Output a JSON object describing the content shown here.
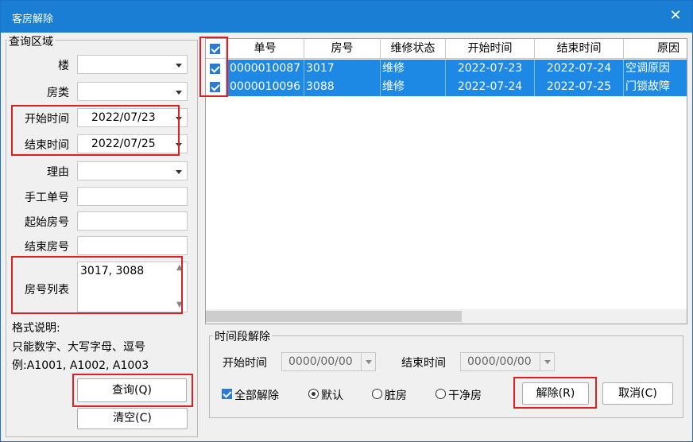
{
  "window": {
    "title": "客房解除",
    "close_icon": "close-icon"
  },
  "query": {
    "group_title": "查询区域",
    "building_label": "楼",
    "room_type_label": "房类",
    "start_time_label": "开始时间",
    "start_time_value": "2022/07/23",
    "end_time_label": "结束时间",
    "end_time_value": "2022/07/25",
    "reason_label": "理由",
    "manual_no_label": "手工单号",
    "start_room_label": "起始房号",
    "end_room_label": "结束房号",
    "room_list_label": "房号列表",
    "room_list_value": "3017, 3088",
    "format_title": "格式说明:",
    "format_line1": "只能数字、大写字母、逗号",
    "format_line2": "例:A1001, A1002, A1003",
    "query_button": "查询(Q)",
    "clear_button": "清空(C)"
  },
  "grid": {
    "columns": [
      "单号",
      "房号",
      "维修状态",
      "开始时间",
      "结束时间",
      "原因"
    ],
    "rows": [
      {
        "checked": true,
        "cells": [
          "0000010087",
          "3017",
          "维修",
          "2022-07-23",
          "2022-07-24",
          "空调原因"
        ]
      },
      {
        "checked": true,
        "cells": [
          "0000010096",
          "3088",
          "维修",
          "2022-07-24",
          "2022-07-25",
          "门锁故障"
        ]
      }
    ]
  },
  "period": {
    "group_title": "时间段解除",
    "start_label": "开始时间",
    "start_value": "0000/00/00",
    "end_label": "结束时间",
    "end_value": "0000/00/00",
    "all_release_label": "全部解除",
    "all_release_checked": true,
    "radio_default": "默认",
    "radio_dirty": "脏房",
    "radio_clean": "干净房",
    "selected_radio": "默认",
    "release_button": "解除(R)",
    "cancel_button": "取消(C)"
  },
  "colors": {
    "titlebar": "#1a7fd4",
    "selection": "#1e88e5",
    "highlight": "#e02020"
  }
}
